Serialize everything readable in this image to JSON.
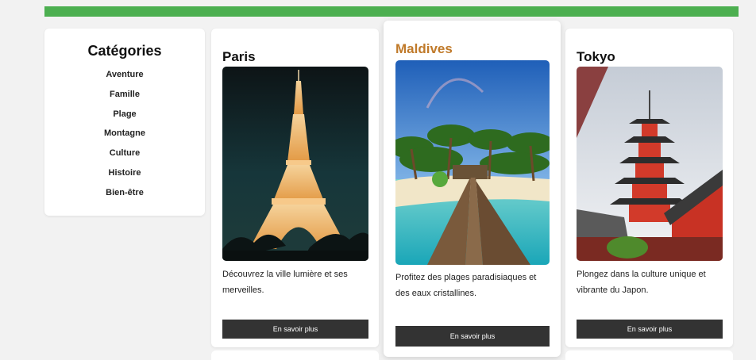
{
  "sidebar": {
    "title": "Catégories",
    "items": [
      "Aventure",
      "Famille",
      "Plage",
      "Montagne",
      "Culture",
      "Histoire",
      "Bien-être"
    ]
  },
  "destinations": [
    {
      "title": "Paris",
      "description": "Découvrez la ville lumière et ses merveilles.",
      "button": "En savoir plus",
      "image": "eiffel-tower-night"
    },
    {
      "title": "Maldives",
      "description": "Profitez des plages paradisiaques et des eaux cristallines.",
      "button": "En savoir plus",
      "image": "tropical-beach-pier"
    },
    {
      "title": "Tokyo",
      "description": "Plongez dans la culture unique et vibrante du Japon.",
      "button": "En savoir plus",
      "image": "japanese-pagoda"
    }
  ],
  "colors": {
    "accent_bar": "#4caf50",
    "highlight_title": "#c07a2a",
    "button_bg": "#333333"
  }
}
